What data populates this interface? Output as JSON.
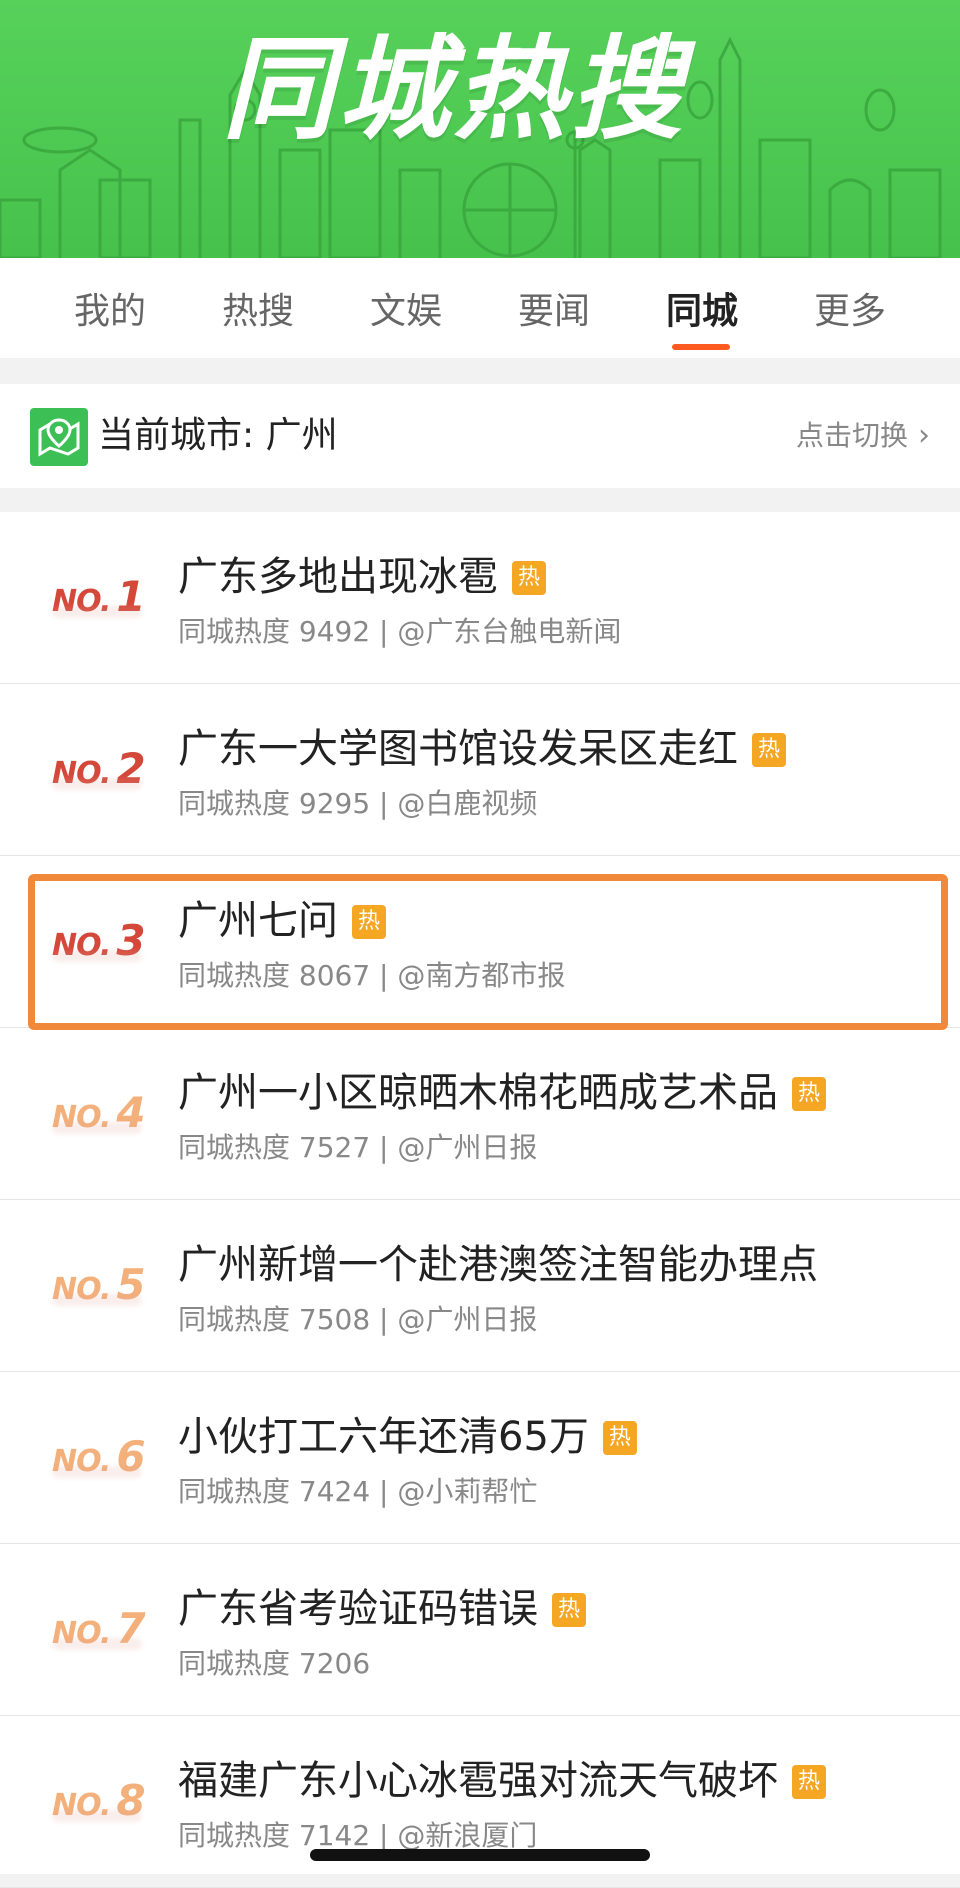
{
  "banner": {
    "title": "同城热搜"
  },
  "tabs": [
    {
      "label": "我的"
    },
    {
      "label": "热搜"
    },
    {
      "label": "文娱"
    },
    {
      "label": "要闻"
    },
    {
      "label": "同城",
      "active": true
    },
    {
      "label": "更多"
    }
  ],
  "city": {
    "label": "当前城市: 广州",
    "switch_label": "点击切换"
  },
  "hot_badge_label": "热",
  "rank_prefix": "NO.",
  "items": [
    {
      "rank": "1",
      "title": "广东多地出现冰雹",
      "hot": true,
      "meta": "同城热度 9492 | @广东台触电新闻",
      "rank_color": "red"
    },
    {
      "rank": "2",
      "title": "广东一大学图书馆设发呆区走红",
      "hot": true,
      "meta": "同城热度 9295 | @白鹿视频",
      "rank_color": "red"
    },
    {
      "rank": "3",
      "title": "广州七问",
      "hot": true,
      "meta": "同城热度 8067 | @南方都市报",
      "rank_color": "red",
      "highlighted": true
    },
    {
      "rank": "4",
      "title": "广州一小区晾晒木棉花晒成艺术品",
      "hot": true,
      "meta": "同城热度 7527 | @广州日报",
      "rank_color": "orange"
    },
    {
      "rank": "5",
      "title": "广州新增一个赴港澳签注智能办理点",
      "hot": false,
      "meta": "同城热度 7508 | @广州日报",
      "rank_color": "orange"
    },
    {
      "rank": "6",
      "title": "小伙打工六年还清65万",
      "hot": true,
      "meta": "同城热度 7424 | @小莉帮忙",
      "rank_color": "orange"
    },
    {
      "rank": "7",
      "title": "广东省考验证码错误",
      "hot": true,
      "meta": "同城热度 7206",
      "rank_color": "orange"
    },
    {
      "rank": "8",
      "title": "福建广东小心冰雹强对流天气破坏",
      "hot": true,
      "meta": "同城热度 7142 | @新浪厦门",
      "rank_color": "orange"
    }
  ],
  "colors": {
    "banner_green": "#4cc852",
    "active_underline": "#ff5a1f",
    "hot_badge": "#f5a623",
    "rank_red": "#d4483a",
    "rank_orange": "#f4b07a",
    "highlight_border": "#f08a3a"
  }
}
